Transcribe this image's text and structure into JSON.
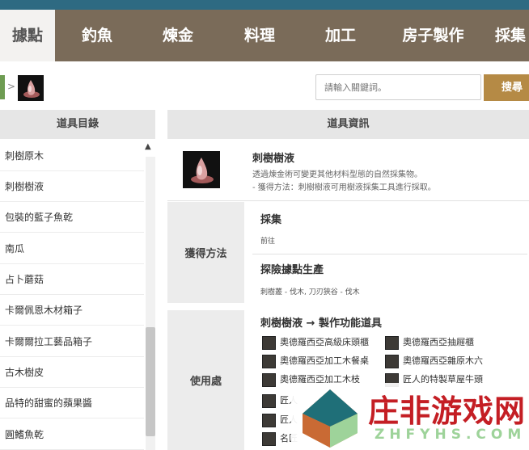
{
  "nav": {
    "tabs": [
      {
        "label": "據點"
      },
      {
        "label": "釣魚"
      },
      {
        "label": "煉金"
      },
      {
        "label": "料理"
      },
      {
        "label": "加工"
      },
      {
        "label": "房子製作"
      },
      {
        "label": "採集"
      }
    ]
  },
  "breadcrumb": {
    "separator": ">"
  },
  "search": {
    "placeholder": "請輸入關鍵詞。",
    "button_label": "搜尋"
  },
  "left_panel": {
    "title": "道具目錄",
    "items": [
      "刺樹原木",
      "刺樹樹液",
      "包裝的藍子魚乾",
      "南瓜",
      "占卜蘑菇",
      "卡爾佩恩木材箱子",
      "卡爾爾拉工藝品箱子",
      "古木樹皮",
      "品特的甜蜜的蘋果醬",
      "圓鰭魚乾"
    ]
  },
  "right_panel": {
    "title": "道具資訊",
    "item": {
      "name": "刺樹樹液",
      "description": "透過煉金術可變更其他材料型態的自然採集物。",
      "method": "- 獲得方法：刺樹樹液可用樹液採集工具進行採取。"
    },
    "obtain": {
      "label": "獲得方法",
      "sections": [
        {
          "title": "採集",
          "text": "前往"
        },
        {
          "title": "探險據點生產",
          "text": "刺樹叢 - 伐木, 刀刃狹谷 - 伐木"
        }
      ]
    },
    "usage": {
      "label": "使用處",
      "title": "刺樹樹液 → 製作功能道具",
      "products": [
        "奧德羅西亞高級床頭櫃",
        "奧德羅西亞抽屜櫃",
        "奧德羅西亞加工木餐桌",
        "奧德羅西亞雜原木六",
        "奧德羅西亞加工木枝",
        "匠人的特製草屋牛頭",
        "匠人",
        "匠人",
        "名匠"
      ]
    }
  },
  "watermark": {
    "text": "庄非游戏网",
    "sub": "ZHFYHS.COM"
  },
  "colors": {
    "nav_bg": "#7a6b59",
    "accent": "#b58a45",
    "top_strip": "#2e6a82",
    "watermark_red": "#c41e24"
  }
}
